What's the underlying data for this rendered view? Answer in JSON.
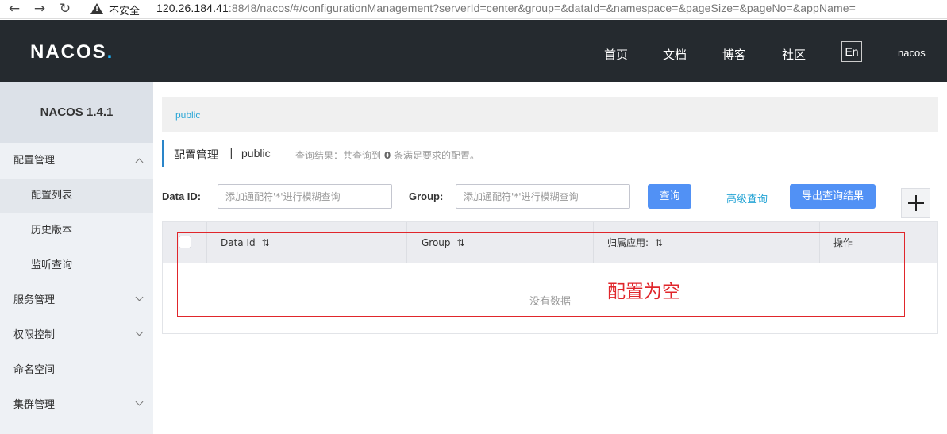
{
  "browser": {
    "back_glyph": "←",
    "forward_glyph": "→",
    "reload_glyph": "↻",
    "security_label": "不安全",
    "url_host": "120.26.184.41",
    "url_rest": ":8848/nacos/#/configurationManagement?serverId=center&group=&dataId=&namespace=&pageSize=&pageNo=&appName="
  },
  "header": {
    "logo_main": "NACOS",
    "logo_dot": ".",
    "nav": [
      "首页",
      "文档",
      "博客",
      "社区"
    ],
    "lang": "En",
    "user": "nacos"
  },
  "sidebar": {
    "title": "NACOS 1.4.1",
    "items": [
      {
        "label": "配置管理",
        "type": "group",
        "expanded": true
      },
      {
        "label": "配置列表",
        "type": "sub",
        "active": true
      },
      {
        "label": "历史版本",
        "type": "sub"
      },
      {
        "label": "监听查询",
        "type": "sub"
      },
      {
        "label": "服务管理",
        "type": "group",
        "expanded": false
      },
      {
        "label": "权限控制",
        "type": "group",
        "expanded": false
      },
      {
        "label": "命名空间",
        "type": "item"
      },
      {
        "label": "集群管理",
        "type": "group",
        "expanded": false
      }
    ]
  },
  "main": {
    "namespace_link": "public",
    "title": "配置管理",
    "title_sep": "|",
    "title_ns": "public",
    "query_result_prefix": "查询结果：共查询到",
    "query_result_count": "0",
    "query_result_suffix": "条满足要求的配置。",
    "dataid_label": "Data ID:",
    "dataid_placeholder": "添加通配符'*'进行模糊查询",
    "group_label": "Group:",
    "group_placeholder": "添加通配符'*'进行模糊查询",
    "search_btn": "查询",
    "advanced_link": "高级查询",
    "export_btn": "导出查询结果"
  },
  "table": {
    "columns": [
      "Data Id",
      "Group",
      "归属应用:",
      "操作"
    ],
    "sort_glyph": "⇅",
    "empty_text": "没有数据"
  },
  "annotation": {
    "text": "配置为空",
    "color": "#e0262b"
  }
}
